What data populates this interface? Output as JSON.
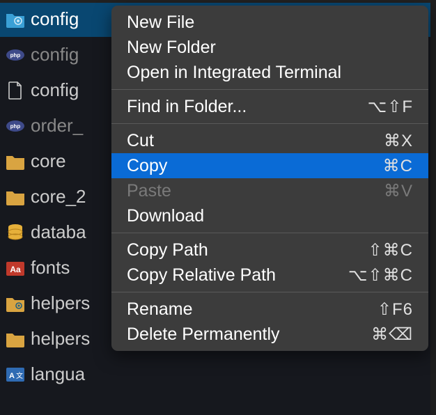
{
  "explorer": {
    "items": [
      {
        "label": "config",
        "icon": "folder-config",
        "selected": true,
        "dimmed": false
      },
      {
        "label": "config",
        "icon": "php",
        "selected": false,
        "dimmed": true
      },
      {
        "label": "config",
        "icon": "file",
        "selected": false,
        "dimmed": false
      },
      {
        "label": "order_",
        "icon": "php",
        "selected": false,
        "dimmed": true
      },
      {
        "label": "core",
        "icon": "folder",
        "selected": false,
        "dimmed": false
      },
      {
        "label": "core_2",
        "icon": "folder",
        "selected": false,
        "dimmed": false
      },
      {
        "label": "databa",
        "icon": "database",
        "selected": false,
        "dimmed": false
      },
      {
        "label": "fonts",
        "icon": "fonts",
        "selected": false,
        "dimmed": false
      },
      {
        "label": "helpers",
        "icon": "folder-gear",
        "selected": false,
        "dimmed": false
      },
      {
        "label": "helpers",
        "icon": "folder",
        "selected": false,
        "dimmed": false
      },
      {
        "label": "langua",
        "icon": "language",
        "selected": false,
        "dimmed": false
      }
    ]
  },
  "contextMenu": {
    "groups": [
      [
        {
          "label": "New File",
          "shortcut": "",
          "disabled": false
        },
        {
          "label": "New Folder",
          "shortcut": "",
          "disabled": false
        },
        {
          "label": "Open in Integrated Terminal",
          "shortcut": "",
          "disabled": false
        }
      ],
      [
        {
          "label": "Find in Folder...",
          "shortcut": "⌥⇧F",
          "disabled": false
        }
      ],
      [
        {
          "label": "Cut",
          "shortcut": "⌘X",
          "disabled": false
        },
        {
          "label": "Copy",
          "shortcut": "⌘C",
          "disabled": false,
          "highlighted": true
        },
        {
          "label": "Paste",
          "shortcut": "⌘V",
          "disabled": true
        },
        {
          "label": "Download",
          "shortcut": "",
          "disabled": false
        }
      ],
      [
        {
          "label": "Copy Path",
          "shortcut": "⇧⌘C",
          "disabled": false
        },
        {
          "label": "Copy Relative Path",
          "shortcut": "⌥⇧⌘C",
          "disabled": false
        }
      ],
      [
        {
          "label": "Rename",
          "shortcut": "⇧F6",
          "disabled": false
        },
        {
          "label": "Delete Permanently",
          "shortcut": "⌘⌫",
          "disabled": false
        }
      ]
    ]
  }
}
